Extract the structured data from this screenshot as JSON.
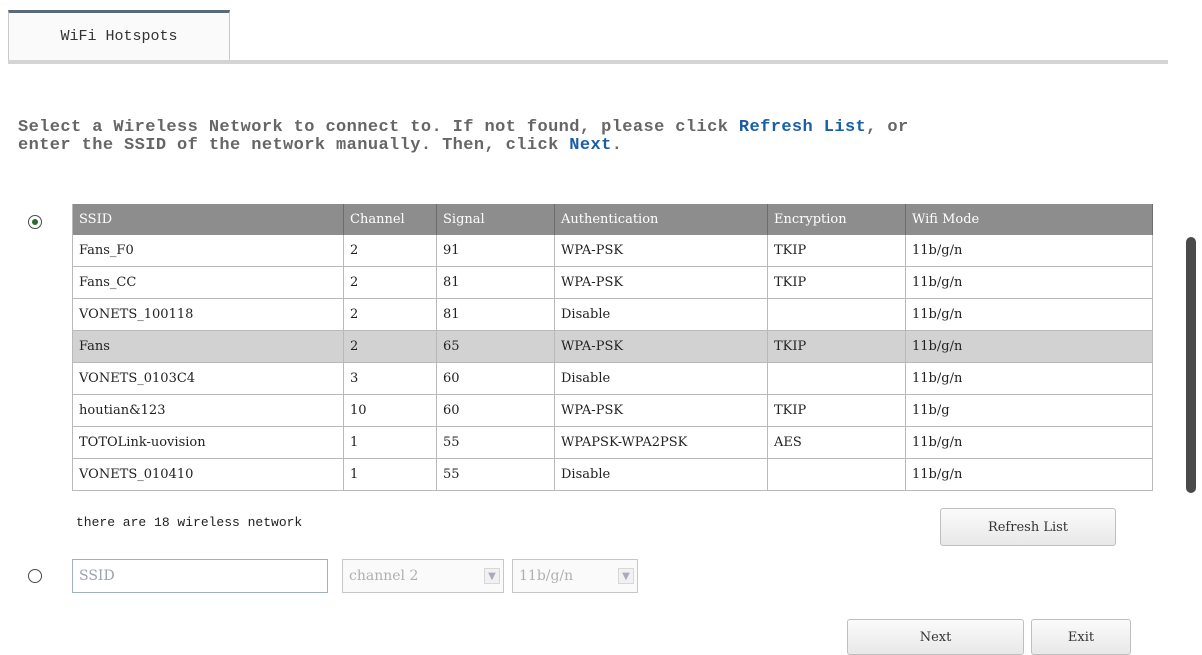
{
  "tab": {
    "label": "WiFi Hotspots"
  },
  "instructions": {
    "part1": "Select a Wireless Network to connect to. If not found, please click ",
    "refresh_link": "Refresh List",
    "part2": ", or",
    "part3": "enter the SSID of the network manually. Then, click ",
    "next_link": "Next",
    "part4": "."
  },
  "table": {
    "headers": [
      "SSID",
      "Channel",
      "Signal",
      "Authentication",
      "Encryption",
      "Wifi Mode"
    ],
    "rows": [
      [
        "Fans_F0",
        "2",
        "91",
        "WPA-PSK",
        "TKIP",
        "11b/g/n"
      ],
      [
        "Fans_CC",
        "2",
        "81",
        "WPA-PSK",
        "TKIP",
        "11b/g/n"
      ],
      [
        "VONETS_100118",
        "2",
        "81",
        "Disable",
        "",
        "11b/g/n"
      ],
      [
        "Fans",
        "2",
        "65",
        "WPA-PSK",
        "TKIP",
        "11b/g/n"
      ],
      [
        "VONETS_0103C4",
        "3",
        "60",
        "Disable",
        "",
        "11b/g/n"
      ],
      [
        "houtian&123",
        "10",
        "60",
        "WPA-PSK",
        "TKIP",
        "11b/g"
      ],
      [
        "TOTOLink-uovision",
        "1",
        "55",
        "WPAPSK-WPA2PSK",
        "AES",
        "11b/g/n"
      ],
      [
        "VONETS_010410",
        "1",
        "55",
        "Disable",
        "",
        "11b/g/n"
      ]
    ]
  },
  "network_count": "there are 18 wireless network",
  "buttons": {
    "refresh": "Refresh List",
    "next": "Next",
    "exit": "Exit"
  },
  "manual": {
    "ssid_placeholder": "SSID",
    "channel_value": "channel 2",
    "mode_value": "11b/g/n"
  }
}
